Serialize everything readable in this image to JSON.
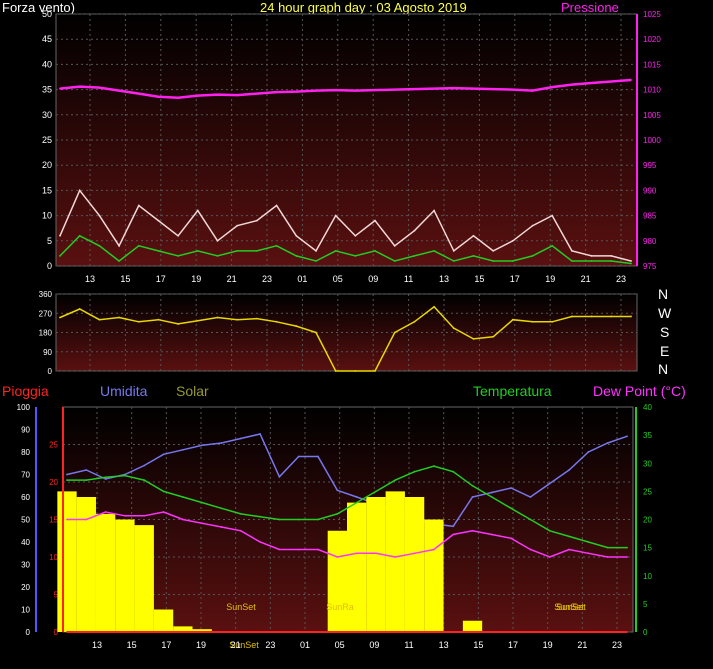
{
  "header": {
    "left_title": "Forza vento)",
    "center_title": "24 hour graph day : 03 Agosto 2019",
    "right_title": "Pressione"
  },
  "direction_letters": [
    "N",
    "W",
    "S",
    "E",
    "N"
  ],
  "bottom_header": {
    "rain": "Pioggia",
    "humidity": "Umidita",
    "solar": "Solar",
    "temperature": "Temperatura",
    "dewpoint": "Dew Point (°C)"
  },
  "colors": {
    "pressure": "#ff22ee",
    "gust": "#f2d7d7",
    "wind_avg": "#22cc22",
    "direction": "#e8d800",
    "humidity": "#7777ee",
    "solar": "#ffff00",
    "temperature": "#22cc22",
    "dewpoint": "#ff33ff",
    "rain": "#ff2222"
  },
  "x_hour_labels": [
    "13",
    "15",
    "17",
    "19",
    "21",
    "23",
    "01",
    "05",
    "09",
    "11",
    "13",
    "15",
    "17",
    "19",
    "21",
    "23"
  ],
  "sun_labels": [
    "SunSet",
    "SunSet",
    "SunRa",
    "SunSet",
    "SunSet"
  ],
  "chart_data": [
    {
      "type": "line",
      "name": "wind_pressure",
      "y_left_ticks": [
        "0",
        "5",
        "10",
        "15",
        "20",
        "25",
        "30",
        "35",
        "40",
        "45",
        "50"
      ],
      "y_right_ticks": [
        "975",
        "980",
        "985",
        "990",
        "995",
        "1000",
        "1005",
        "1010",
        "1015",
        "1020",
        "1025"
      ],
      "ylim_left": [
        0,
        50
      ],
      "ylim_right": [
        975,
        1025
      ],
      "series": [
        {
          "key": "pressure",
          "axis": "right",
          "values": [
            1010.2,
            1010.6,
            1010.4,
            1009.8,
            1009.2,
            1008.6,
            1008.4,
            1008.8,
            1009.0,
            1008.9,
            1009.2,
            1009.5,
            1009.6,
            1009.8,
            1009.9,
            1009.8,
            1009.9,
            1010.0,
            1010.1,
            1010.2,
            1010.3,
            1010.2,
            1010.1,
            1010.0,
            1009.8,
            1010.5,
            1011.0,
            1011.3,
            1011.6,
            1011.9
          ]
        },
        {
          "key": "gust",
          "axis": "left",
          "values": [
            6,
            15,
            10,
            4,
            12,
            9,
            6,
            11,
            5,
            8,
            9,
            12,
            6,
            3,
            10,
            6,
            9,
            4,
            7,
            11,
            3,
            6,
            3,
            5,
            8,
            10,
            3,
            2,
            2,
            1
          ]
        },
        {
          "key": "wind_avg",
          "axis": "left",
          "values": [
            2,
            6,
            4,
            1,
            4,
            3,
            2,
            3,
            2,
            3,
            3,
            4,
            2,
            1,
            3,
            2,
            3,
            1,
            2,
            3,
            1,
            2,
            1,
            1,
            2,
            4,
            1,
            1,
            1,
            0.5
          ]
        }
      ]
    },
    {
      "type": "line",
      "name": "wind_direction",
      "y_ticks": [
        "360",
        "270",
        "180",
        "90",
        "0"
      ],
      "ylim": [
        0,
        360
      ],
      "series": [
        {
          "key": "direction",
          "values": [
            250,
            290,
            240,
            250,
            230,
            240,
            220,
            235,
            250,
            240,
            245,
            230,
            210,
            180,
            0,
            0,
            0,
            180,
            230,
            300,
            200,
            150,
            160,
            240,
            230,
            230,
            255,
            255,
            255,
            255
          ]
        }
      ]
    },
    {
      "type": "line",
      "name": "climate",
      "y_rain_ticks": [
        "0",
        "10",
        "20",
        "30",
        "40",
        "50",
        "60",
        "70",
        "80",
        "90",
        "100"
      ],
      "y_left_ticks": [
        "0",
        "5",
        "10",
        "15",
        "20",
        "25"
      ],
      "y_right_ticks": [
        "0",
        "5",
        "10",
        "15",
        "20",
        "25",
        "30",
        "35",
        "40"
      ],
      "ylim_left": [
        0,
        30
      ],
      "ylim_right": [
        0,
        40
      ],
      "series": [
        {
          "key": "humidity",
          "axis": "rain",
          "values": [
            70,
            72,
            68,
            70,
            74,
            79,
            81,
            83,
            84,
            86,
            88,
            69,
            78,
            78,
            63,
            60,
            57,
            53,
            50,
            48,
            47,
            60,
            62,
            64,
            60,
            66,
            72,
            80,
            84,
            87
          ]
        },
        {
          "key": "solar",
          "axis": "right",
          "values": [
            25,
            24,
            21,
            20,
            19,
            4,
            1,
            0.5,
            0,
            0,
            0,
            0,
            0,
            0,
            18,
            23,
            24,
            25,
            24,
            20,
            0,
            2,
            0,
            0,
            0,
            0,
            0,
            0,
            0,
            0
          ]
        },
        {
          "key": "temperature",
          "axis": "right",
          "values": [
            27,
            27,
            27.5,
            27.8,
            27,
            25,
            24,
            23,
            22,
            21,
            20.5,
            20,
            20,
            20,
            21,
            23,
            25,
            27,
            28.5,
            29.5,
            28.5,
            26,
            24,
            22,
            20,
            18,
            17,
            16,
            15,
            15
          ]
        },
        {
          "key": "dewpoint",
          "axis": "left",
          "values": [
            15,
            15,
            16,
            15.5,
            15.5,
            16,
            15,
            14.5,
            14,
            13.5,
            12,
            11,
            11,
            11,
            10,
            10.5,
            10.5,
            10,
            10.5,
            11,
            13,
            13.5,
            13,
            12.5,
            11,
            10,
            11,
            10.5,
            10,
            10
          ]
        },
        {
          "key": "rain",
          "axis": "left",
          "values": [
            0,
            0,
            0,
            0,
            0,
            0,
            0,
            0,
            0,
            0,
            0,
            0,
            0,
            0,
            0,
            0,
            0,
            0,
            0,
            0,
            0,
            0,
            0,
            0,
            0,
            0,
            0,
            0,
            0,
            0
          ]
        }
      ]
    }
  ]
}
